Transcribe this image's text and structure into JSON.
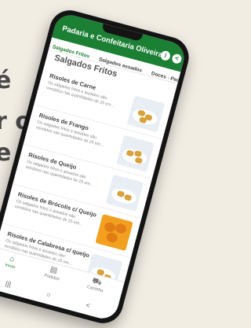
{
  "background": {
    "line1": "é",
    "line2": "r o",
    "line3": "e"
  },
  "app": {
    "title": "Padaria e Confeitaria Oliveira",
    "accent": "#1b7f34",
    "info_icon": "info-icon",
    "share_icon": "share-icon"
  },
  "tabs": [
    {
      "label": "Salgados Fritos",
      "active": true
    },
    {
      "label": "Salgados assados",
      "active": false
    },
    {
      "label": "Doces - Pedidos",
      "active": false
    }
  ],
  "section": {
    "title": "Salgados Fritos"
  },
  "products": [
    {
      "name": "Risoles de Carne",
      "desc": "Os salgados fritos e assados são vendidos nas quantidades de 25 em..."
    },
    {
      "name": "Risoles de Frango",
      "desc": "Os salgados fritos e assados são vendidos nas quantidades de 25 em..."
    },
    {
      "name": "Risoles de Queijo",
      "desc": "Os salgados fritos e assados são vendidos nas quantidades de 25 em..."
    },
    {
      "name": "Risoles de Brócolis c/ Queijo",
      "desc": "Os salgados fritos e assados são vendidos nas quantidades de 25 em..."
    },
    {
      "name": "Risoles de Calabresa c/ queijo",
      "desc": "Os salgados fritos e assados são vendidos nas quantidades de 25 em..."
    }
  ],
  "bottom_nav": [
    {
      "label": "Início",
      "icon": "home-icon",
      "active": true
    },
    {
      "label": "Pedidos",
      "icon": "orders-icon",
      "active": false
    },
    {
      "label": "Carrinho",
      "icon": "cart-icon",
      "active": false
    }
  ],
  "system_nav": {
    "recent": "|||",
    "home": "○",
    "back": "<"
  }
}
